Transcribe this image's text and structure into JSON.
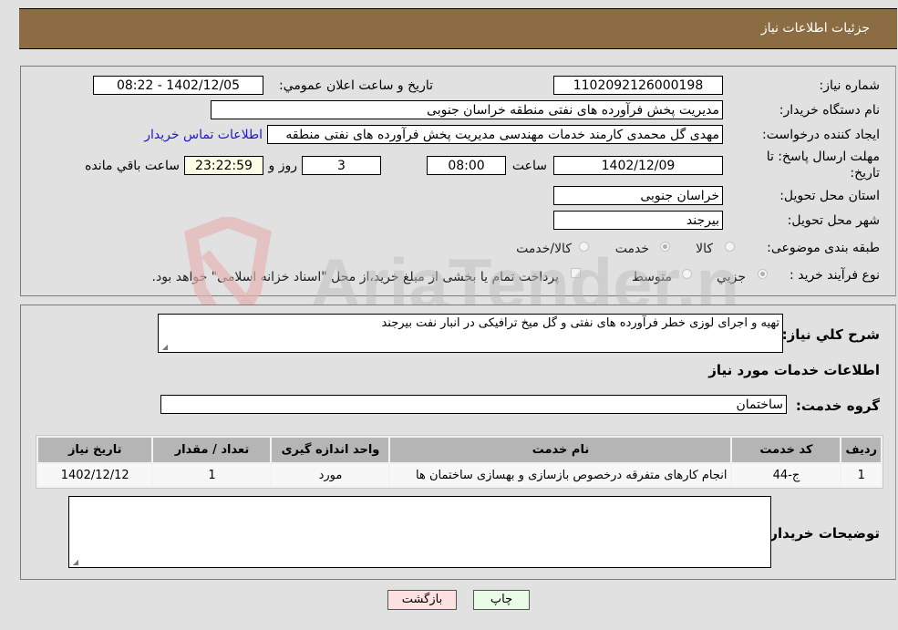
{
  "header": {
    "title": "جزئیات اطلاعات نیاز"
  },
  "details": {
    "need_number": {
      "label": "شماره نیاز:",
      "value": "1102092126000198"
    },
    "announce": {
      "label": "تاريخ و ساعت اعلان عمومي:",
      "value": "1402/12/05 - 08:22"
    },
    "buyer_org": {
      "label": "نام دستگاه خریدار:",
      "value": "مدیریت پخش فرآورده های نفتی منطقه خراسان جنوبی"
    },
    "requester": {
      "label": "ایجاد کننده درخواست:",
      "value": "مهدی گل محمدی کارمند خدمات مهندسی مدیریت پخش فرآورده های نفتی منطقه",
      "contact_link": "اطلاعات تماس خریدار"
    },
    "deadline": {
      "label_line1": "مهلت ارسال پاسخ: تا",
      "label_line2": "تاریخ:",
      "date": "1402/12/09",
      "time_label": "ساعت",
      "time": "08:00",
      "days": "3",
      "days_label": "روز و",
      "remaining": "23:22:59",
      "remaining_label": "ساعت باقي مانده"
    },
    "province": {
      "label": "استان محل تحویل:",
      "value": "خراسان جنوبی"
    },
    "city": {
      "label": "شهر محل تحویل:",
      "value": "بیرجند"
    },
    "category": {
      "label": "طبقه بندی موضوعی:",
      "options": [
        {
          "label": "کالا",
          "checked": false
        },
        {
          "label": "خدمت",
          "checked": true
        },
        {
          "label": "کالا/خدمت",
          "checked": false
        }
      ]
    },
    "purchase_type": {
      "label": "نوع فرآیند خرید :",
      "options": [
        {
          "label": "جزيي",
          "checked": true
        },
        {
          "label": "متوسط",
          "checked": false
        }
      ],
      "treasury_note": "پرداخت تمام یا بخشی از مبلغ خرید،از محل \"اسناد خزانه اسلامی\" خواهد بود.",
      "treasury_checked": false
    }
  },
  "description": {
    "label": "شرح كلي نياز:",
    "value": "تهیه و اجرای لوزی خطر فرآورده های نفتی و گل میخ ترافیکی در انبار نفت بیرجند"
  },
  "services": {
    "section_title": "اطلاعات خدمات مورد نياز",
    "group_label": "گروه خدمت:",
    "group_value": "ساختمان",
    "columns": [
      "ردیف",
      "کد خدمت",
      "نام خدمت",
      "واحد اندازه گیری",
      "تعداد / مقدار",
      "تاریخ نیاز"
    ],
    "rows": [
      [
        "1",
        "ج-44",
        "انجام کارهای متفرقه درخصوص بازسازی و بهسازی ساختمان ها",
        "مورد",
        "1",
        "1402/12/12"
      ]
    ]
  },
  "buyer_notes": {
    "label": "توضیحات خریدار:",
    "value": ""
  },
  "buttons": {
    "print": "چاپ",
    "back": "بازگشت"
  },
  "watermark": {
    "text": "AriaTender.neT"
  },
  "colors": {
    "header": "#8c6d43",
    "link": "#1a1acc",
    "print_btn": "#e9fde6",
    "back_btn": "#fde0e0"
  }
}
